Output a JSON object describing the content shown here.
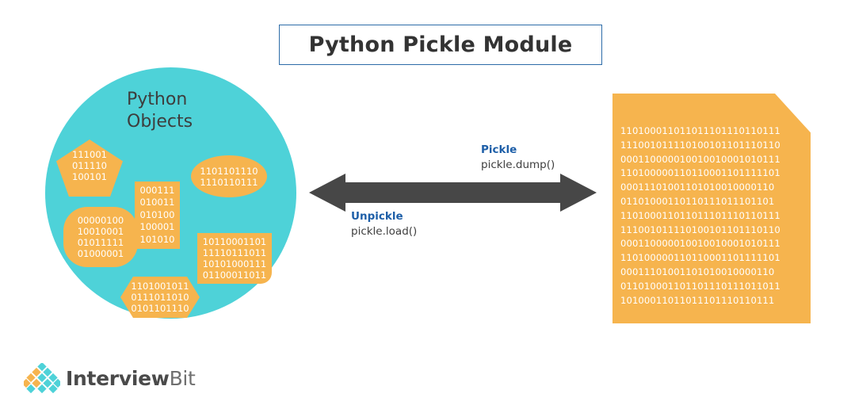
{
  "title": {
    "text": "Python Pickle Module",
    "border_color": "#2d6ca8"
  },
  "colors": {
    "cyan": "#4ED2D8",
    "orange": "#F6B44E",
    "arrow": "#474747",
    "accent_blue": "#1e5fa8",
    "text_dark": "#3f3f3f"
  },
  "left": {
    "heading": "Python\nObjects",
    "objects": [
      {
        "name": "pentagon",
        "lines": [
          "111001",
          "011110",
          "100101"
        ]
      },
      {
        "name": "rounded",
        "lines": [
          "00000100",
          "10010001",
          "01011111",
          "01000001"
        ]
      },
      {
        "name": "rectangle",
        "lines": [
          "000111",
          "010011",
          "010100",
          "100001",
          "101010"
        ]
      },
      {
        "name": "ellipse",
        "lines": [
          "1101101110",
          "1110110111"
        ]
      },
      {
        "name": "block",
        "lines": [
          "10110001101",
          "11110111011",
          "10101000111",
          "01100011011"
        ]
      },
      {
        "name": "hexagon",
        "lines": [
          "1101001011",
          "0111011010",
          "0101101110"
        ]
      }
    ]
  },
  "arrow": {
    "icon": "double-headed-arrow-icon",
    "pickle": {
      "keyword": "Pickle",
      "code": "pickle.dump()"
    },
    "unpickle": {
      "keyword": "Unpickle",
      "code": "pickle.load()"
    }
  },
  "document": {
    "icon": "binary-file-icon",
    "bit_rows": [
      "11010001101101110111 0110111",
      "11100101111010010110 1110110",
      "00011000001001001000 1010111",
      "11010000011011000110 1111101",
      "00011101001101010010 000110",
      "01101000110110111011 101101",
      "11010001101101110111 0110111",
      "11100101111010010110 1110110",
      "00011000001001001000 1010111",
      "11010000011011000110 1111101",
      "00011101001101010010 000110",
      "01101000110110111011 1011011",
      "10100011011011101110 110111"
    ]
  },
  "footer": {
    "logo_name": "interviewbit-logo",
    "brand_first": "Interview",
    "brand_second": "Bit"
  }
}
